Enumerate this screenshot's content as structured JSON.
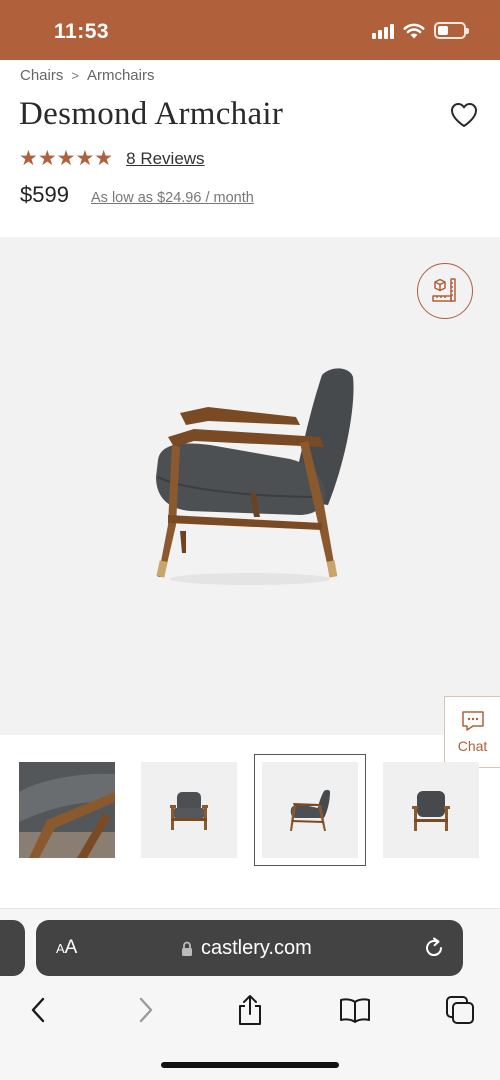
{
  "status_bar": {
    "time": "11:53",
    "background": "#b0603a",
    "battery_level": 0.35
  },
  "breadcrumb": {
    "items": [
      "Chairs",
      "Armchairs"
    ],
    "separator": ">"
  },
  "product": {
    "title": "Desmond Armchair",
    "rating": 5,
    "stars": "★★★★★",
    "reviews_label": "8 Reviews",
    "price": "$599",
    "installment": "As low as $24.96  / month"
  },
  "icons": {
    "wishlist": "heart-outline-icon",
    "dimensions": "cube-ruler-icon",
    "chat": "chat-bubble-icon",
    "lock": "lock-icon",
    "reload": "reload-icon",
    "back": "chevron-left-icon",
    "forward": "chevron-right-icon",
    "share": "share-icon",
    "bookmarks": "open-book-icon",
    "tabs": "tabs-icon"
  },
  "chat": {
    "label": "Chat"
  },
  "gallery": {
    "thumbnail_count": 4,
    "active_index": 2
  },
  "browser": {
    "aa_label_small": "A",
    "aa_label_large": "A",
    "url": "castlery.com"
  },
  "colors": {
    "accent": "#b0603a",
    "text": "#222222",
    "muted": "#777777",
    "gallery_bg": "#f2f2f2"
  }
}
